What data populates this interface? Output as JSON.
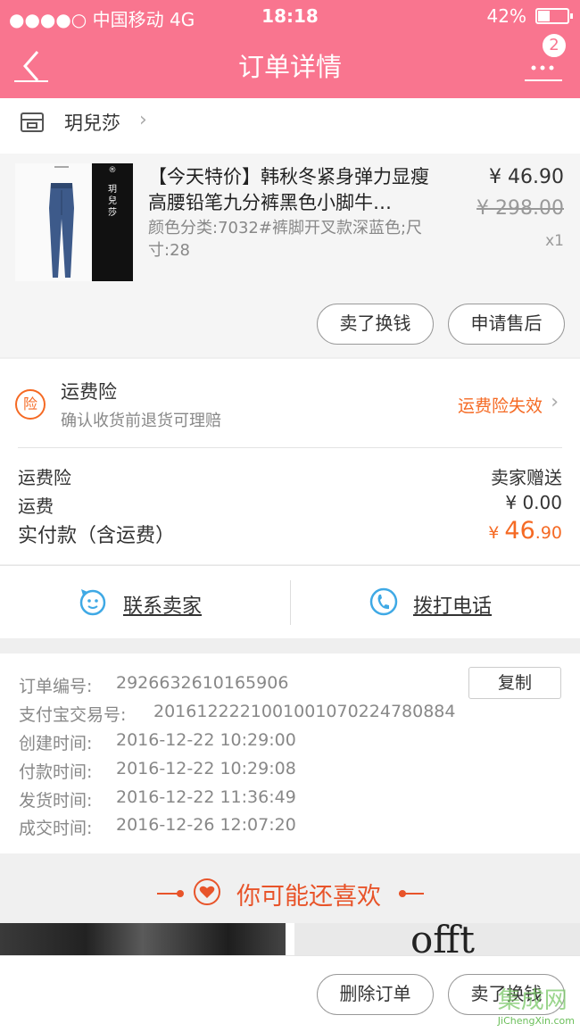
{
  "status_bar": {
    "carrier": "●●●●○ 中国移动  4G",
    "time": "18:18",
    "battery": "42%",
    "battery_fraction": 0.42
  },
  "header": {
    "title": "订单详情",
    "badge_count": "2"
  },
  "shop": {
    "name": "玥兒莎"
  },
  "product": {
    "title": "【今天特价】韩秋冬紧身弹力显瘦高腰铅笔九分裤黑色小脚牛…",
    "spec": "颜色分类:7032#裤脚开叉款深蓝色;尺寸:28",
    "price": "¥ 46.90",
    "original_price": "¥ 298.00",
    "quantity": "x1",
    "image_text": "玥兒莎",
    "buttons": {
      "sell": "卖了换钱",
      "after_sale": "申请售后"
    }
  },
  "insurance": {
    "icon_text": "险",
    "title": "运费险",
    "subtitle": "确认收货前退货可理赔",
    "status": "运费险失效"
  },
  "fees": [
    {
      "label": "运费险",
      "value": "卖家赠送"
    },
    {
      "label": "运费",
      "value": "¥ 0.00"
    }
  ],
  "total": {
    "label": "实付款（含运费）",
    "currency": "¥ ",
    "integer": "46",
    "decimal": ".90"
  },
  "contact": {
    "seller": "联系卖家",
    "phone": "拨打电话"
  },
  "order_info": {
    "copy_label": "复制",
    "rows": [
      {
        "label": "订单编号:",
        "value": "2926632610165906"
      },
      {
        "label": "支付宝交易号:",
        "value": "2016122221001001070224780884"
      },
      {
        "label": "创建时间:",
        "value": "2016-12-22 10:29:00"
      },
      {
        "label": "付款时间:",
        "value": "2016-12-22 10:29:08"
      },
      {
        "label": "发货时间:",
        "value": "2016-12-22 11:36:49"
      },
      {
        "label": "成交时间:",
        "value": "2016-12-26 12:07:20"
      }
    ]
  },
  "recommend": {
    "title": "你可能还喜欢"
  },
  "bottom": {
    "delete": "删除订单",
    "sell": "卖了换钱"
  },
  "watermark": {
    "main": "集成网",
    "url": "JiChengXin.com"
  },
  "colors": {
    "header": "#f9758f",
    "accent": "#f56a24",
    "link_blue": "#3fa9e5"
  },
  "icons": [
    "back-arrow",
    "more-dots",
    "shop",
    "chevron-right",
    "insurance-badge",
    "chat-face",
    "phone",
    "heart"
  ]
}
